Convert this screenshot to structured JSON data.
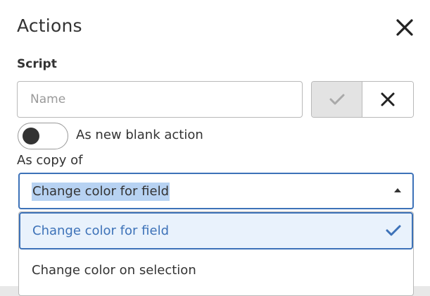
{
  "dialog": {
    "title": "Actions",
    "close_icon": "close-icon"
  },
  "script": {
    "label": "Script",
    "name_placeholder": "Name",
    "name_value": "",
    "confirm_icon": "check-icon",
    "cancel_icon": "close-icon"
  },
  "new_blank": {
    "label": "As new blank action",
    "toggle_on": false
  },
  "copy": {
    "label": "As copy of",
    "selected_value": "Change color for field",
    "caret_icon": "caret-up-icon",
    "options": [
      {
        "label": "Change color for field",
        "selected": true
      },
      {
        "label": "Change color on selection",
        "selected": false
      }
    ]
  },
  "colors": {
    "accent": "#3d72b8",
    "selection_highlight": "#b7d2f2",
    "option_selected_bg": "#e9f2fc",
    "text": "#333333",
    "placeholder": "#9a9a9a"
  }
}
